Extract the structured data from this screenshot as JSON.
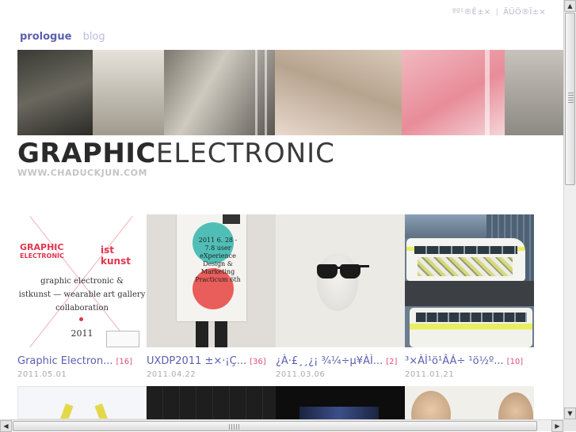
{
  "utility_links": [
    "ºº¹®Ê±×",
    "ÄÜÖ®Ï±×"
  ],
  "nav": {
    "prologue": "prologue",
    "blog": "blog"
  },
  "logo": {
    "bold": "GRAPHIC",
    "light": "ELECTRONIC"
  },
  "site_url": "WWW.CHADUCKJUN.COM",
  "thumb1_text": {
    "graphic": "GRAPHIC",
    "electronic": "ELECTRONIC",
    "istkunst": "ist kunst",
    "line1": "graphic electronic &",
    "line2": "istkunst — wearable art gallery",
    "line3": "collaboration",
    "year": "2011"
  },
  "thumb2_text": "2011 6. 28 - 7.8 user eXperience Design & Marketing Practicum 6th",
  "posts": [
    {
      "title": "Graphic Electron...",
      "count": "[16]",
      "date": "2011.05.01"
    },
    {
      "title": "UXDP2011 ±×·¡Ç...",
      "count": "[36]",
      "date": "2011.04.22"
    },
    {
      "title": "¿À·£¸¸¿¡ ¾¼÷µ¥ÀÌ...",
      "count": "[2]",
      "date": "2011.03.06"
    },
    {
      "title": "³×ÀÌ¹ö¹ÂÁ÷ ¹ö½º...",
      "count": "[10]",
      "date": "2011.01.21"
    }
  ],
  "scrollbar_arrows": {
    "up": "▲",
    "down": "▼",
    "left": "◀",
    "right": "▶"
  }
}
